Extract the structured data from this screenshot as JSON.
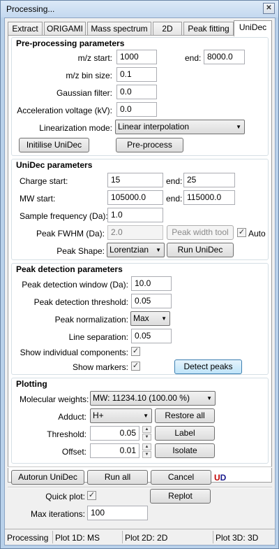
{
  "window": {
    "title": "Processing...",
    "close_glyph": "✕"
  },
  "tabs": [
    "Extract",
    "ORIGAMI",
    "Mass spectrum",
    "2D",
    "Peak fitting",
    "UniDec"
  ],
  "preprocessing": {
    "title": "Pre-processing parameters",
    "mz_start_label": "m/z start:",
    "mz_start": "1000",
    "end_label": "end:",
    "mz_end": "8000.0",
    "bin_size_label": "m/z bin size:",
    "bin_size": "0.1",
    "gaussian_label": "Gaussian filter:",
    "gaussian": "0.0",
    "accel_label": "Acceleration voltage (kV):",
    "accel": "0.0",
    "linearization_label": "Linearization mode:",
    "linearization": "Linear interpolation",
    "initialise_btn": "Initilise UniDec",
    "preprocess_btn": "Pre-process"
  },
  "unidec": {
    "title": "UniDec parameters",
    "charge_start_label": "Charge start:",
    "charge_start": "15",
    "charge_end_label": "end:",
    "charge_end": "25",
    "mw_start_label": "MW start:",
    "mw_start": "105000.0",
    "mw_end_label": "end:",
    "mw_end": "115000.0",
    "sample_freq_label": "Sample frequency (Da):",
    "sample_freq": "1.0",
    "fwhm_label": "Peak FWHM (Da):",
    "fwhm": "2.0",
    "peak_width_btn": "Peak width tool",
    "auto_label": "Auto",
    "auto_checked": "✓",
    "peak_shape_label": "Peak Shape:",
    "peak_shape": "Lorentzian",
    "run_btn": "Run UniDec"
  },
  "peak_detection": {
    "title": "Peak detection parameters",
    "window_label": "Peak detection window (Da):",
    "window": "10.0",
    "threshold_label": "Peak detection threshold:",
    "threshold": "0.05",
    "normalization_label": "Peak normalization:",
    "normalization": "Max",
    "line_sep_label": "Line separation:",
    "line_sep": "0.05",
    "show_components_label": "Show individual components:",
    "show_components": "✓",
    "show_markers_label": "Show markers:",
    "show_markers": "✓",
    "detect_btn": "Detect peaks"
  },
  "plotting": {
    "title": "Plotting",
    "mw_label": "Molecular weights:",
    "mw_value": "MW: 11234.10 (100.00 %)",
    "adduct_label": "Adduct:",
    "adduct": "H+",
    "restore_btn": "Restore all",
    "threshold_label": "Threshold:",
    "threshold": "0.05",
    "label_btn": "Label",
    "offset_label": "Offset:",
    "offset": "0.01",
    "isolate_btn": "Isolate"
  },
  "bottom": {
    "autorun_btn": "Autorun UniDec",
    "run_all_btn": "Run all",
    "cancel_btn": "Cancel",
    "logo_u": "U",
    "logo_d": "D",
    "quick_plot_label": "Quick plot:",
    "quick_plot": "✓",
    "replot_btn": "Replot",
    "max_iter_label": "Max iterations:",
    "max_iter": "100"
  },
  "status": {
    "state": "Processing",
    "plot1d": "Plot 1D: MS",
    "plot2d": "Plot 2D: 2D",
    "plot3d": "Plot 3D: 3D"
  },
  "icons": {
    "dropdown": "▼",
    "spin_up": "▲",
    "spin_down": "▼"
  }
}
